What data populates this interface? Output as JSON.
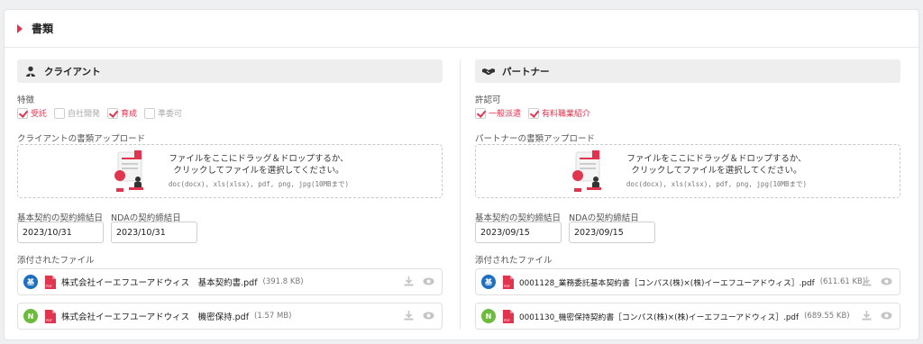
{
  "header": {
    "title": "書類"
  },
  "client": {
    "title": "クライアント",
    "features_label": "特徴",
    "features": [
      {
        "label": "受託",
        "checked": true
      },
      {
        "label": "自社開発",
        "checked": false
      },
      {
        "label": "育成",
        "checked": true
      },
      {
        "label": "準委可",
        "checked": false
      }
    ],
    "upload_label": "クライアントの書類アップロード",
    "upload_line1": "ファイルをここにドラッグ＆ドロップするか、",
    "upload_line2": "クリックしてファイルを選択してください。",
    "upload_formats": "doc(docx), xls(xlsx), pdf, png, jpg(10MBまで)",
    "date1_label": "基本契約の契約締結日",
    "date1_value": "2023/10/31",
    "date2_label": "NDAの契約締結日",
    "date2_value": "2023/10/31",
    "files_label": "添付されたファイル",
    "files": [
      {
        "badge": "基",
        "badge_color": "#1e6fbf",
        "name": "株式会社イーエフユーアドウィス　基本契約書.pdf",
        "size": "(391.8 KB)"
      },
      {
        "badge": "N",
        "badge_color": "#6cbb3c",
        "name": "株式会社イーエフユーアドウィス　機密保持.pdf",
        "size": "(1.57 MB)"
      }
    ]
  },
  "partner": {
    "title": "パートナー",
    "features_label": "許認可",
    "features": [
      {
        "label": "一般派遣",
        "checked": true
      },
      {
        "label": "有料職業紹介",
        "checked": true
      }
    ],
    "upload_label": "パートナーの書類アップロード",
    "upload_line1": "ファイルをここにドラッグ＆ドロップするか、",
    "upload_line2": "クリックしてファイルを選択してください。",
    "upload_formats": "doc(docx), xls(xlsx), pdf, png, jpg(10MBまで)",
    "date1_label": "基本契約の契約締結日",
    "date1_value": "2023/09/15",
    "date2_label": "NDAの契約締結日",
    "date2_value": "2023/09/15",
    "files_label": "添付されたファイル",
    "files": [
      {
        "badge": "基",
        "badge_color": "#1e6fbf",
        "name": "0001128_業務委託基本契約書［コンパス(株)×(株)イーエフユーアドウィス］.pdf",
        "size": "(611.61 KB)"
      },
      {
        "badge": "N",
        "badge_color": "#6cbb3c",
        "name": "0001130_機密保持契約書［コンパス(株)×(株)イーエフユーアドウィス］.pdf",
        "size": "(689.55 KB)"
      }
    ]
  },
  "icons": {
    "accent": "#e0344f",
    "client_icon": "person-icon",
    "partner_icon": "handshake-icon"
  }
}
